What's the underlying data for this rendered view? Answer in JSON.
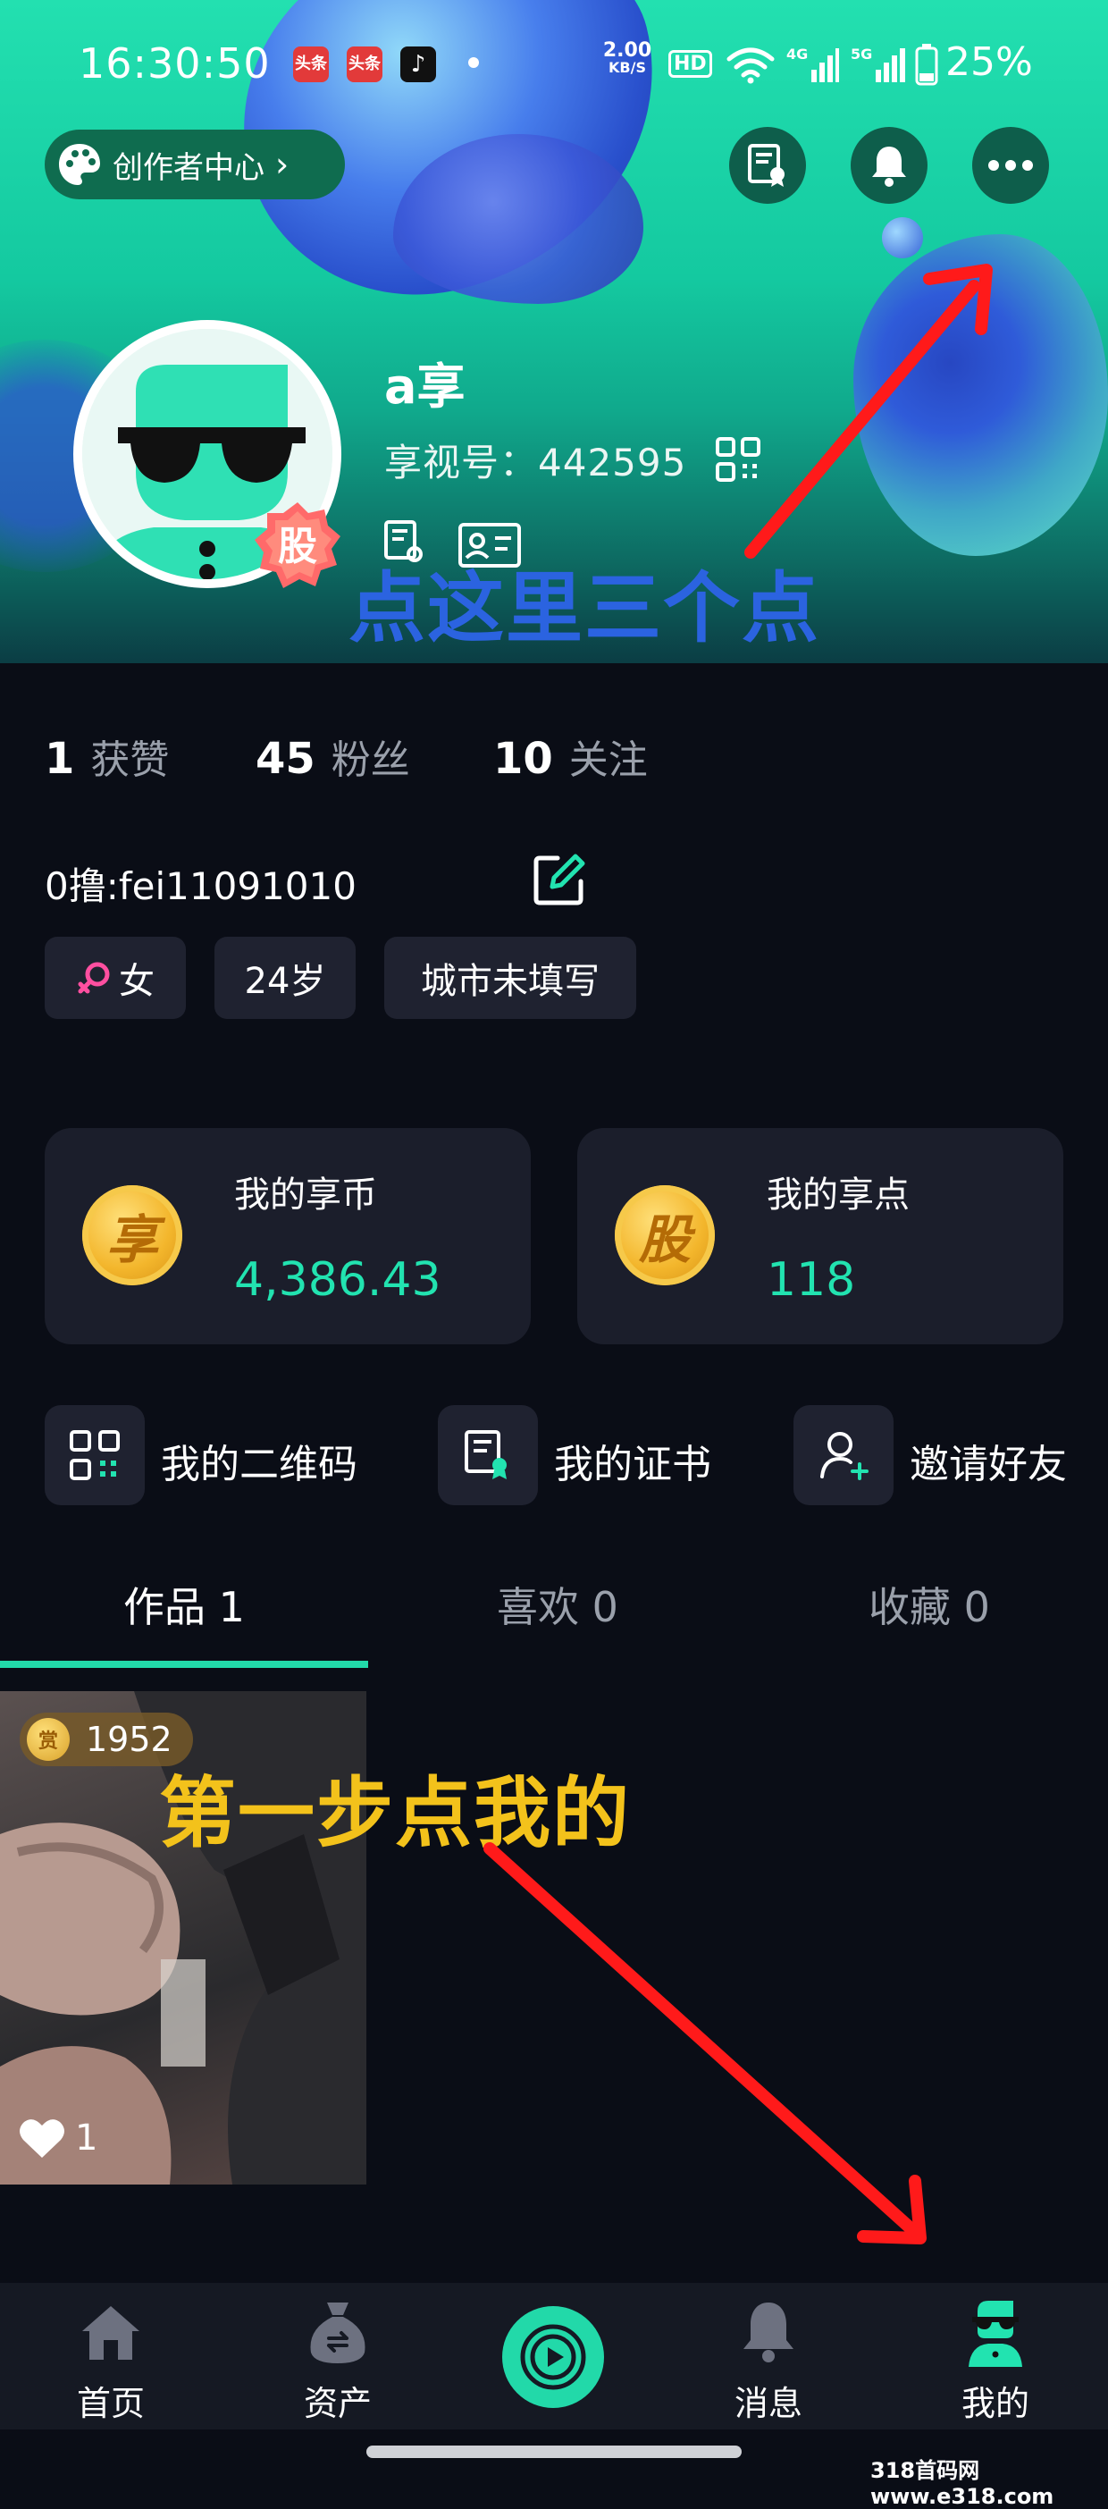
{
  "status_bar": {
    "time": "16:30:50",
    "apps": [
      "头条",
      "头条"
    ],
    "net_speed": "2.00",
    "net_unit": "KB/S",
    "hd": "HD",
    "battery": "25%"
  },
  "header": {
    "creator_center_label": "创作者中心",
    "gu_badge": "股"
  },
  "profile": {
    "name": "a享",
    "id_label": "享视号：442595"
  },
  "annotations": {
    "top_note": "点这里三个点",
    "step_note": "第一步点我的"
  },
  "stats": [
    {
      "num": "1",
      "label": "获赞"
    },
    {
      "num": "45",
      "label": "粉丝"
    },
    {
      "num": "10",
      "label": "关注"
    }
  ],
  "bio": "0撸:fei11091010",
  "tags": {
    "gender": "女",
    "age": "24岁",
    "city": "城市未填写"
  },
  "wallet": {
    "coins": {
      "title": "我的享币",
      "value": "4,386.43",
      "glyph": "享"
    },
    "points": {
      "title": "我的享点",
      "value": "118",
      "glyph": "股"
    }
  },
  "quick_actions": [
    {
      "label": "我的二维码",
      "icon": "qr-code-icon"
    },
    {
      "label": "我的证书",
      "icon": "certificate-icon"
    },
    {
      "label": "邀请好友",
      "icon": "add-friend-icon"
    }
  ],
  "tabs": [
    {
      "label": "作品 1",
      "active": true
    },
    {
      "label": "喜欢 0",
      "active": false
    },
    {
      "label": "收藏 0",
      "active": false
    }
  ],
  "video": {
    "coin_badge": "赏",
    "coins": "1952",
    "likes": "1"
  },
  "bottom_nav": [
    {
      "label": "首页",
      "icon": "home-icon"
    },
    {
      "label": "资产",
      "icon": "money-bag-icon"
    },
    {
      "label": "",
      "icon": "play-icon"
    },
    {
      "label": "消息",
      "icon": "bell-icon"
    },
    {
      "label": "我的",
      "icon": "profile-icon"
    }
  ],
  "watermark": "318首码网 www.e318.com",
  "colors": {
    "accent": "#22e3b0",
    "background": "#0a0d16",
    "card": "#1b1e2b",
    "annotation_blue": "#2b63e0",
    "annotation_yellow": "#f3c21b",
    "arrow_red": "#ff1a1a"
  }
}
